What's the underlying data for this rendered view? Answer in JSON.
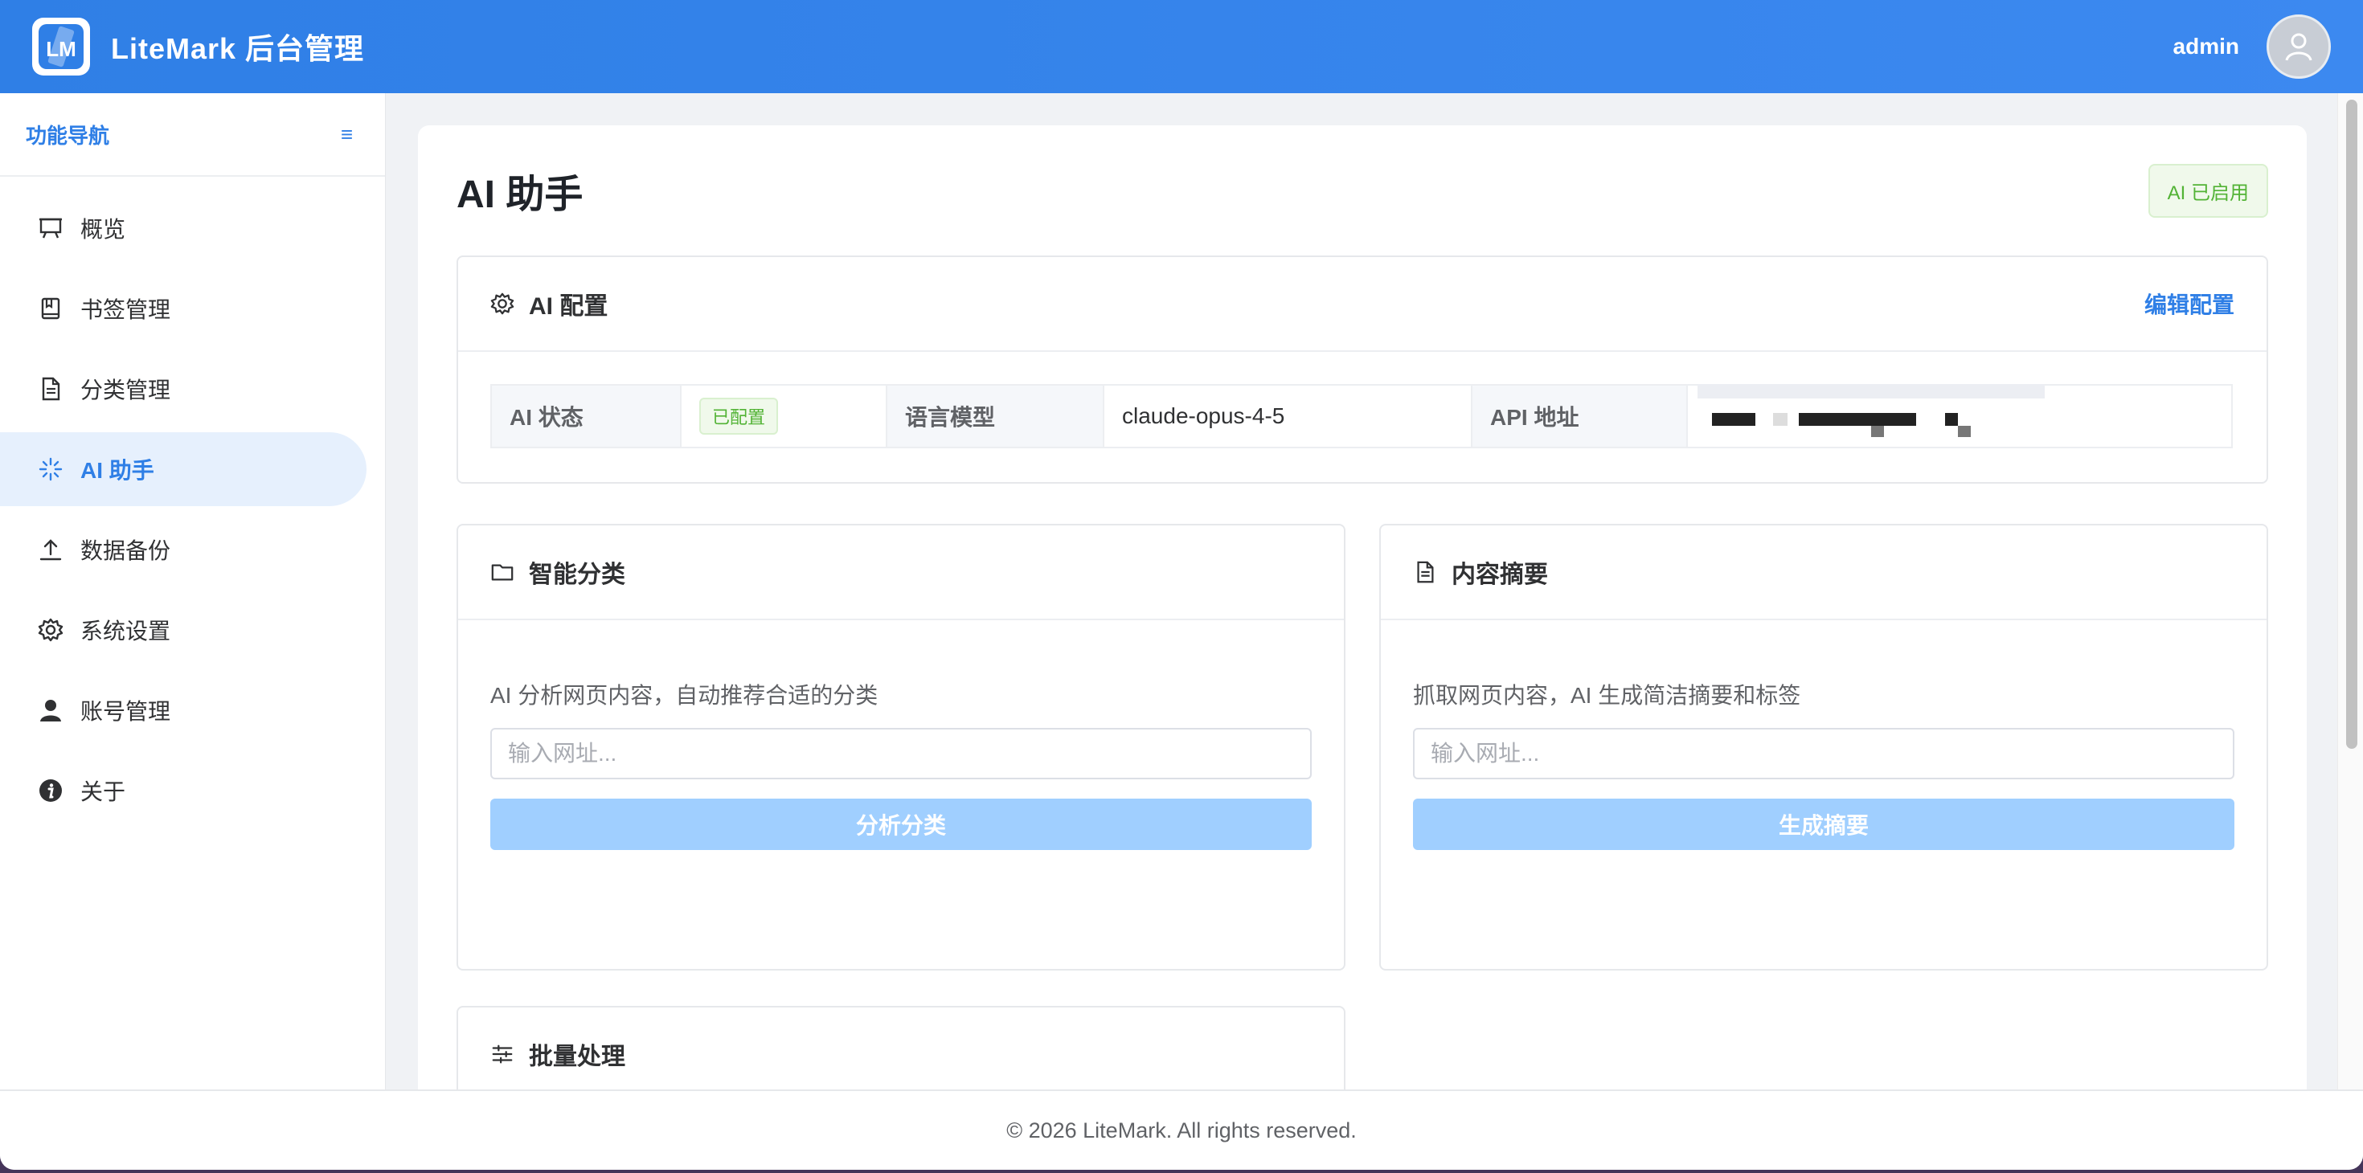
{
  "header": {
    "logo_text": "LM",
    "app_title": "LiteMark 后台管理",
    "username": "admin"
  },
  "sidebar": {
    "title": "功能导航",
    "collapse_icon": "≡",
    "items": [
      {
        "label": "概览",
        "icon": "presentation-board-icon"
      },
      {
        "label": "书签管理",
        "icon": "notebook-icon"
      },
      {
        "label": "分类管理",
        "icon": "document-icon"
      },
      {
        "label": "AI 助手",
        "icon": "sparkle-loader-icon",
        "active": true
      },
      {
        "label": "数据备份",
        "icon": "upload-icon"
      },
      {
        "label": "系统设置",
        "icon": "gear-icon"
      },
      {
        "label": "账号管理",
        "icon": "user-icon"
      },
      {
        "label": "关于",
        "icon": "info-icon"
      }
    ]
  },
  "page": {
    "title": "AI 助手",
    "status_tag": "AI 已启用"
  },
  "ai_config": {
    "title": "AI 配置",
    "edit_label": "编辑配置",
    "status_label": "AI 状态",
    "status_value": "已配置",
    "model_label": "语言模型",
    "model_value": "claude-opus-4-5",
    "api_label": "API 地址"
  },
  "smart_category": {
    "title": "智能分类",
    "description": "AI 分析网页内容，自动推荐合适的分类",
    "placeholder": "输入网址...",
    "button_label": "分析分类"
  },
  "summary": {
    "title": "内容摘要",
    "description": "抓取网页内容，AI 生成简洁摘要和标签",
    "placeholder": "输入网址...",
    "button_label": "生成摘要"
  },
  "batch": {
    "title": "批量处理"
  },
  "footer": {
    "text": "© 2026 LiteMark. All rights reserved."
  },
  "colors": {
    "primary": "#2f7fe6",
    "success": "#52b335",
    "disabled_button": "#a0cfff"
  }
}
